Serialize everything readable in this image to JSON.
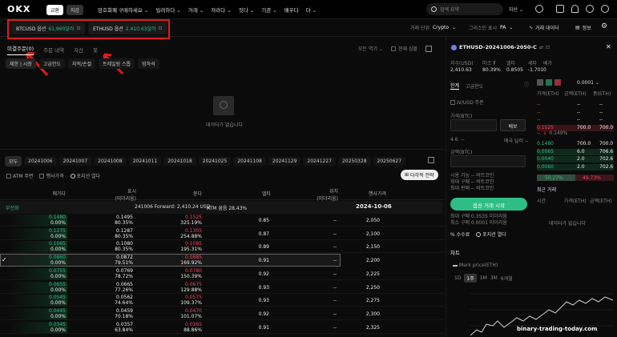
{
  "topbar": {
    "logo": "OKX",
    "tab_trade": "교환",
    "tab_wallet": "지갑",
    "menu": [
      "암호화폐 구매하세요 ⌄",
      "빌려하다 ⌄",
      "거래 ⌄",
      "자라다 ⌄",
      "짓다 ⌄",
      "기관 ⌄",
      "배우다",
      "더 ⌄"
    ],
    "search_placeholder": "검색 요약",
    "assets": "자산 ⌄"
  },
  "tickers": [
    {
      "name": "BTCUSD 옵션",
      "price": "61,960달러"
    },
    {
      "name": "ETHUSD 옵션",
      "price": "2,410.63달러"
    }
  ],
  "toolbar": {
    "unit_label": "거래 단위",
    "unit_value": "Crypto",
    "greeks_label": "그리스인 표시",
    "greeks_value": "PA",
    "trade_data": "거래 데이터",
    "info": "정보"
  },
  "orders": {
    "tabs": [
      "미결주문(0)",
      "주문 내역",
      "자산",
      "봇"
    ],
    "active_tab": 0,
    "subtabs": [
      "제한 | 시장",
      "고급한도",
      "지적/손절",
      "트레일링 스톱",
      "빙하석"
    ],
    "all_symbols": "모든 역기 ⌄",
    "current_symbol": "현재 심볼",
    "empty": "데이터가 없습니다"
  },
  "expiry": {
    "all": "모두",
    "dates": [
      "20241006",
      "20241007",
      "20241008",
      "20241011",
      "20241018",
      "20241025",
      "20241108",
      "20241129",
      "20241227",
      "20250328",
      "20250627"
    ],
    "atm": "ATM 주변",
    "exercise": "행사가격",
    "position": "포지션 열다",
    "multi": "다각적 전략"
  },
  "chain": {
    "headers": [
      "메가다",
      "표시\n(미더리움)",
      "묻다",
      "델타",
      "위치\n(미더리움)",
      "행사가격"
    ],
    "forward": "241006 Forward: 2,410.24 USD",
    "atm_iv": "ATM 꿈음 28.43%",
    "side": "부전화",
    "date": "2024-10-06",
    "rows": [
      {
        "bid": "0.1480",
        "bid_pct": "0.00%",
        "mark": "0.1495",
        "mark_pct": "80.35%",
        "ask": "0.1525",
        "ask_pct": "325.19%",
        "delta": "0.85",
        "pos": "--",
        "strike": "2,050"
      },
      {
        "bid": "0.1275",
        "bid_pct": "0.00%",
        "mark": "0.1287",
        "mark_pct": "80.35%",
        "ask": "0.1305",
        "ask_pct": "254.88%",
        "delta": "0.87",
        "pos": "--",
        "strike": "2,100"
      },
      {
        "bid": "0.1065",
        "bid_pct": "0.00%",
        "mark": "0.1080",
        "mark_pct": "80.35%",
        "ask": "0.1085",
        "ask_pct": "195.31%",
        "delta": "0.89",
        "pos": "--",
        "strike": "2,150"
      },
      {
        "bid": "0.0860",
        "bid_pct": "0.00%",
        "mark": "0.0872",
        "mark_pct": "79.51%",
        "ask": "0.0885",
        "ask_pct": "169.92%",
        "delta": "0.91",
        "pos": "--",
        "strike": "2,200"
      },
      {
        "bid": "0.0755",
        "bid_pct": "0.00%",
        "mark": "0.0769",
        "mark_pct": "78.72%",
        "ask": "0.0780",
        "ask_pct": "150.39%",
        "delta": "0.92",
        "pos": "--",
        "strike": "2,225"
      },
      {
        "bid": "0.0655",
        "bid_pct": "0.00%",
        "mark": "0.0665",
        "mark_pct": "77.26%",
        "ask": "0.0675",
        "ask_pct": "129.88%",
        "delta": "0.93",
        "pos": "--",
        "strike": "2,250"
      },
      {
        "bid": "0.0545",
        "bid_pct": "0.00%",
        "mark": "0.0562",
        "mark_pct": "74.64%",
        "ask": "0.0575",
        "ask_pct": "109.37%",
        "delta": "0.93",
        "pos": "--",
        "strike": "2,275"
      },
      {
        "bid": "0.0445",
        "bid_pct": "0.00%",
        "mark": "0.0459",
        "mark_pct": "70.18%",
        "ask": "0.0470",
        "ask_pct": "101.07%",
        "delta": "0.92",
        "pos": "--",
        "strike": "2,300"
      },
      {
        "bid": "0.0345",
        "bid_pct": "0.00%",
        "mark": "0.0357",
        "mark_pct": "63.84%",
        "ask": "0.0365",
        "ask_pct": "88.86%",
        "delta": "0.91",
        "pos": "--",
        "strike": "2,325"
      }
    ],
    "selected_row": 3
  },
  "panel": {
    "symbol": "ETHUSD-20241006-2050-C",
    "stat_labels": [
      "지수(USD)",
      "마크 ₮",
      "델타",
      "세타",
      "베가"
    ],
    "stat_values": [
      "2,410.63",
      "80.39%",
      "0.8505",
      "-1.701",
      "0"
    ],
    "stat_sub": [
      "",
      "0.1495",
      "",
      "0",
      ""
    ],
    "order_tabs": [
      "한계",
      "고급한도"
    ],
    "iv_order": "IV/USD 주문",
    "price_label": "가격(BTC)",
    "price_btn": "베보",
    "qty_label": "금액(BTC)",
    "bid_hint": "4.6. --",
    "ask_hint": "매국 달러 --",
    "limits": [
      "시용 가능 -- 비트코인",
      "최대 구매 -- 비트코인",
      "최대 판매 -- 비트코인"
    ],
    "submit": "옵션 거래 시작",
    "max_label": "최대 구매 0.3535 미더리움",
    "min_label": "최소 구매 0.0001 미더리움",
    "fee": "% 수수료",
    "position": "포지션 열다",
    "chart": "차트",
    "mark_price": "Mark price(ETH)",
    "ranges": [
      "1D",
      "1주",
      "1M",
      "3M",
      "6개월"
    ],
    "active_range": 1
  },
  "book": {
    "precision": "0.0001 ⌄",
    "headers": [
      "가격(ETH)",
      "금액(ETH)",
      "총(ETH)"
    ],
    "asks": [
      [
        "--",
        "--",
        "--"
      ],
      [
        "--",
        "--",
        "--"
      ],
      [
        "--",
        "--",
        "--"
      ],
      [
        "0.1525",
        "700.0",
        "700.0"
      ]
    ],
    "spread": "0.149%",
    "bids": [
      [
        "0.1480",
        "700.0",
        "700.0"
      ],
      [
        "0.0065",
        "6.0",
        "706.6"
      ],
      [
        "0.0040",
        "2.0",
        "702.6"
      ],
      [
        "0.0060",
        "2.0",
        "702.6"
      ]
    ],
    "buy_pct": "50.27%",
    "sell_pct": "49.73%",
    "recent": "최근 거래",
    "recent_headers": [
      "시간",
      "가격(ETH)",
      "금액(ETH)"
    ],
    "empty": "데이터가 없습니다"
  },
  "watermark": "binary-trading-today.com"
}
